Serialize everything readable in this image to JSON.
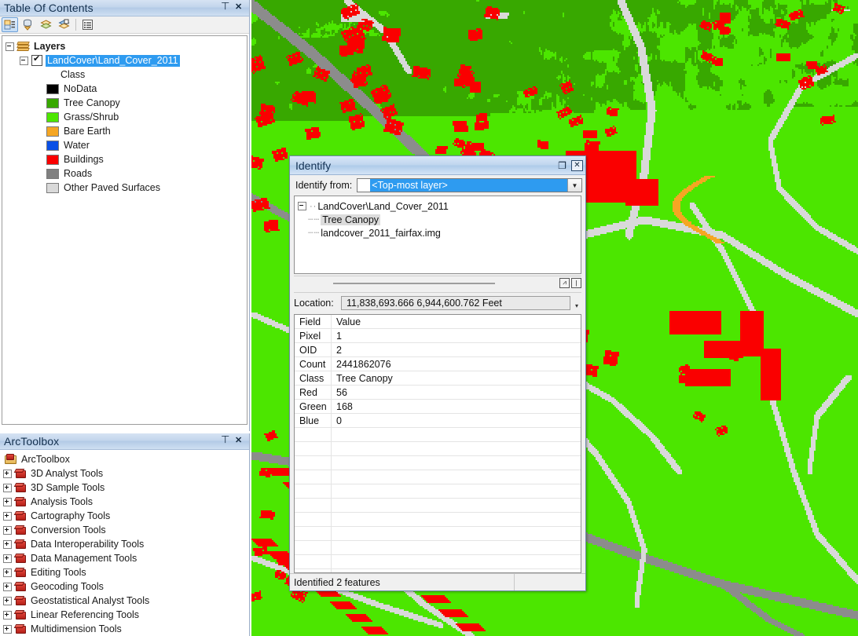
{
  "toc": {
    "title": "Table Of Contents",
    "pin_icon": "pin-icon",
    "close_icon": "close-icon",
    "toolbar": [
      {
        "name": "list-by-drawing-order",
        "active": true
      },
      {
        "name": "list-by-source",
        "active": false
      },
      {
        "name": "list-by-visibility",
        "active": false
      },
      {
        "name": "list-by-selection",
        "active": false
      },
      {
        "name": "options",
        "active": false
      }
    ],
    "root_label": "Layers",
    "layer_label": "LandCover\\Land_Cover_2011",
    "class_label": "Class",
    "legend": [
      {
        "label": "NoData",
        "color": "#000000"
      },
      {
        "label": "Tree Canopy",
        "color": "#38a800"
      },
      {
        "label": "Grass/Shrub",
        "color": "#4ce600"
      },
      {
        "label": "Bare Earth",
        "color": "#f5a623"
      },
      {
        "label": "Water",
        "color": "#0a50e6"
      },
      {
        "label": "Buildings",
        "color": "#fa0000"
      },
      {
        "label": "Roads",
        "color": "#808080"
      },
      {
        "label": "Other Paved Surfaces",
        "color": "#d9d9d9"
      }
    ]
  },
  "arctoolbox": {
    "title": "ArcToolbox",
    "pin_icon": "pin-icon",
    "close_icon": "close-icon",
    "root_label": "ArcToolbox",
    "items": [
      "3D Analyst Tools",
      "3D Sample Tools",
      "Analysis Tools",
      "Cartography Tools",
      "Conversion Tools",
      "Data Interoperability Tools",
      "Data Management Tools",
      "Editing Tools",
      "Geocoding Tools",
      "Geostatistical Analyst Tools",
      "Linear Referencing Tools",
      "Multidimension Tools"
    ]
  },
  "identify": {
    "title": "Identify",
    "restore_label": "❐",
    "close_label": "✕",
    "identify_from_label": "Identify from:",
    "identify_from_value": "<Top-most layer>",
    "tree": {
      "root": "LandCover\\Land_Cover_2011",
      "children": [
        "Tree Canopy",
        "landcover_2011_fairfax.img"
      ],
      "selected": "Tree Canopy"
    },
    "location_label": "Location:",
    "location_value": "11,838,693.666  6,944,600.762 Feet",
    "columns": [
      "Field",
      "Value"
    ],
    "rows": [
      {
        "field": "Pixel",
        "value": "1"
      },
      {
        "field": "OID",
        "value": "2"
      },
      {
        "field": "Count",
        "value": "2441862076"
      },
      {
        "field": "Class",
        "value": "Tree Canopy"
      },
      {
        "field": "Red",
        "value": "56"
      },
      {
        "field": "Green",
        "value": "168"
      },
      {
        "field": "Blue",
        "value": "0"
      }
    ],
    "status": "Identified 2 features"
  },
  "map": {
    "palette": {
      "tree_canopy": "#38a800",
      "grass_shrub": "#4ce600",
      "bare_earth": "#f5a623",
      "water": "#0a50e6",
      "buildings": "#fa0000",
      "roads": "#8c8c8c",
      "other_paved": "#d9d9d9"
    }
  }
}
